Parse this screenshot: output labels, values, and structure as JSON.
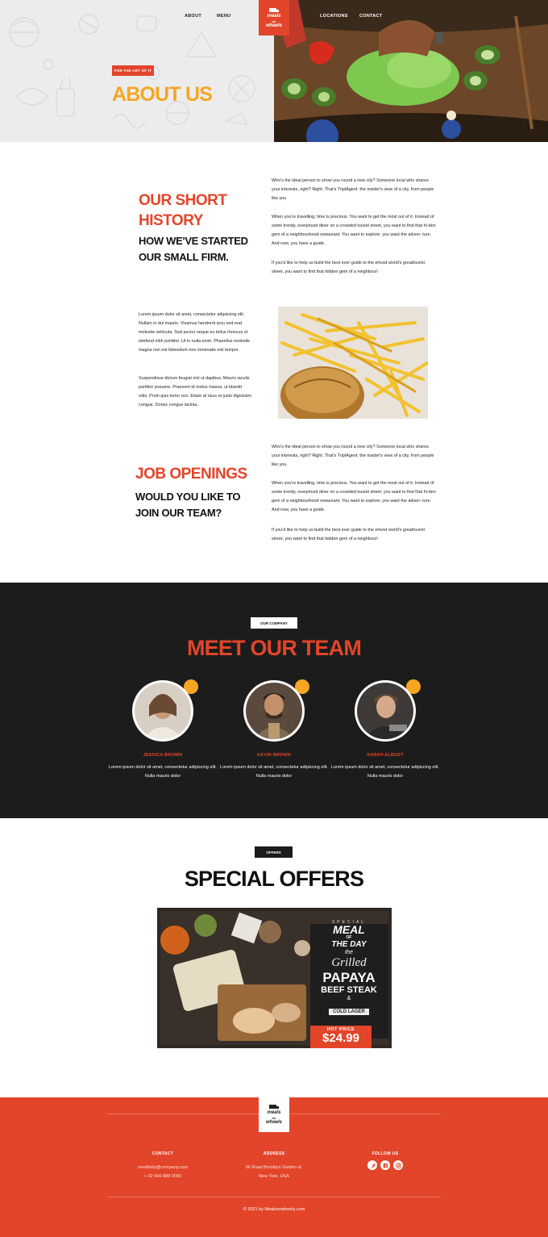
{
  "nav": {
    "about": "ABOUT",
    "menu": "MENU",
    "locations": "LOCATIONS",
    "contact": "CONTACT"
  },
  "logo": {
    "line1": "meals",
    "line2": "on",
    "line3": "wheels"
  },
  "hero": {
    "tag": "FOR THE ART OF IT",
    "title": "ABOUT US"
  },
  "history": {
    "title_line1": "OUR SHORT",
    "title_line2": "HISTORY",
    "sub_line1": "HOW WE'VE STARTED",
    "sub_line2": "OUR SMALL FIRM.",
    "para1": "Who's the ideal person to show you round a new city? Someone local who shares your interests, right? Right. That's TripIAgent: the insider's view of a city, from people like you",
    "para2": "When you're travelling, time is precious. You want to get the most out of it. Instead of some trendy, overpriced diner on a crowded tourist street, you want to find that hi-den gem of a neighbourhood restaurant. You want to explore; you want the adven- ture. And now, you have a guide.",
    "para3": "If you'd like to help us build the best ever guide to the ertvod world's greattourist street, you want to find that hidden gem of a neighbour!"
  },
  "lorem": {
    "para1": "Lorem ipsum dolor sit amet, consectetur adipiscing elit. Nullam in dui mauris. Vivamus hendrerit arcu sed erat molestie vehicula. Sed auctor neque eu tellus rhoncus ut eleifend nibh porttitor. Ut in nulla enim. Phasellus molestie magna non est bibendum non venenatis nisl tempor.",
    "para2": "Suspendisse dictum feugiat nisl ut dapibus. Mauris iaculis porttitor posuere. Praesent id metus massa, ut blandit odio. Proin quis tortor orci. Etiam at risus et justo dignissim congue. Donec congue lacinia.."
  },
  "jobs": {
    "title": "JOB OPENINGS",
    "sub_line1": "WOULD YOU LIKE TO",
    "sub_line2": "JOIN OUR TEAM?",
    "para1": "Who's the ideal person to show you round a new city? Someone local who shares your interests, right? Right. That's TripIAgent: the insider's view of a city, from people like you.",
    "para2": "When you're travelling, time is precious. You want to get the most out of it. Instead of some trendy, overpriced diner on a crowded tourist street, you want to find that hi-den gem of a neighbourhood restaurant. You want to explore; you want the adven- ture. And now, you have a guide.",
    "para3": "If you'd like to help us build the best ever guide to the ertvod world's greattourist street, you want to find that hidden gem of a neighbour!"
  },
  "team": {
    "tag": "OUR COMPANY",
    "title": "MEET OUR TEAM",
    "members": [
      {
        "name": "JESSICA BROWN",
        "desc": "Lorem ipsum dolor sit amet, consectetur adipiscing elit. Nulla mauris dolor"
      },
      {
        "name": "KEVIN BROWN",
        "desc": "Lorem ipsum dolor sit amet, consectetur adipiscing elit. Nulla mauris dolor"
      },
      {
        "name": "SARAH ALBERT",
        "desc": "Lorem ipsum dolor sit amet, consectetur adipiscing elit. Nulla mauris dolor"
      }
    ]
  },
  "offers": {
    "tag": "OFFERS",
    "title": "SPECIAL OFFERS",
    "board": {
      "special": "SPECIAL",
      "meal": "MEAL",
      "of": "OF",
      "the_day": "THE DAY",
      "the": "the",
      "grilled": "Grilled",
      "papaya": "PAPAYA",
      "beef_steak": "BEEF STEAK",
      "amp": "&",
      "cold_lager": "COLD LAGER",
      "hot_price": "HOT PRICE",
      "price": "$24.99"
    }
  },
  "footer": {
    "contact_head": "CONTACT",
    "email": "needhelp@company.com",
    "phone": "+ 92 666 888 0000",
    "address_head": "ADDRESS",
    "address1": "66 Road Brooklyn Golden st.",
    "address2": "New York. USA",
    "follow_head": "FOLLOW US",
    "copyright": "© 2021 by Mealsonwheels.com"
  },
  "colors": {
    "accent": "#e2452a",
    "yellow": "#f6a623",
    "dark": "#1c1c1c"
  }
}
